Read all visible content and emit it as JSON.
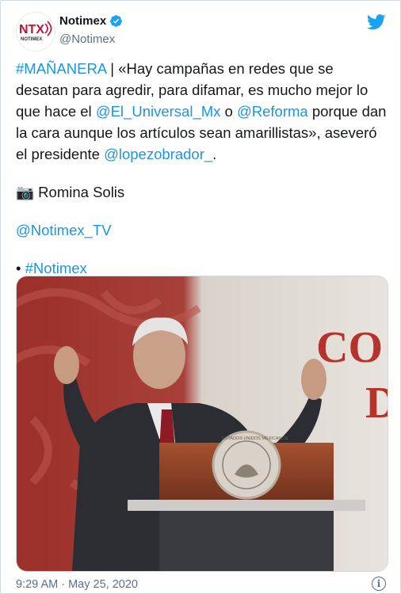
{
  "author": {
    "name": "Notimex",
    "handle": "@Notimex",
    "logo_text": "NTX",
    "logo_sub": "NOTIMEX"
  },
  "tweet": {
    "hashtag_main": "#MAÑANERA",
    "text_1": " | «Hay campañas en redes que se desatan para agredir, para difamar, es mucho mejor lo que hace el ",
    "mention_1": "@El_Universal_Mx",
    "text_2": " o ",
    "mention_2": "@Reforma",
    "text_3": " porque dan la cara aunque los artículos sean amarillistas», aseveró el presidente ",
    "mention_3": "@lopezobrador_",
    "text_4": ".",
    "camera_emoji": "📷",
    "photo_credit": " Romina Solis",
    "tv_handle": "@Notimex_TV",
    "bullet": "• ",
    "hashtag_end": "#Notimex"
  },
  "photo": {
    "backdrop_text_1": "CO",
    "backdrop_text_2": "D",
    "seal_text": "ESTADOS UNIDOS MEXICANOS"
  },
  "footer": {
    "timestamp": "9:29 AM · May 25, 2020"
  },
  "colors": {
    "link": "#1b95e0",
    "verified": "#1da1f2",
    "twitter_bird": "#1da1f2"
  },
  "icons": [
    "verified-badge-icon",
    "twitter-bird-icon",
    "camera-icon",
    "info-icon"
  ]
}
